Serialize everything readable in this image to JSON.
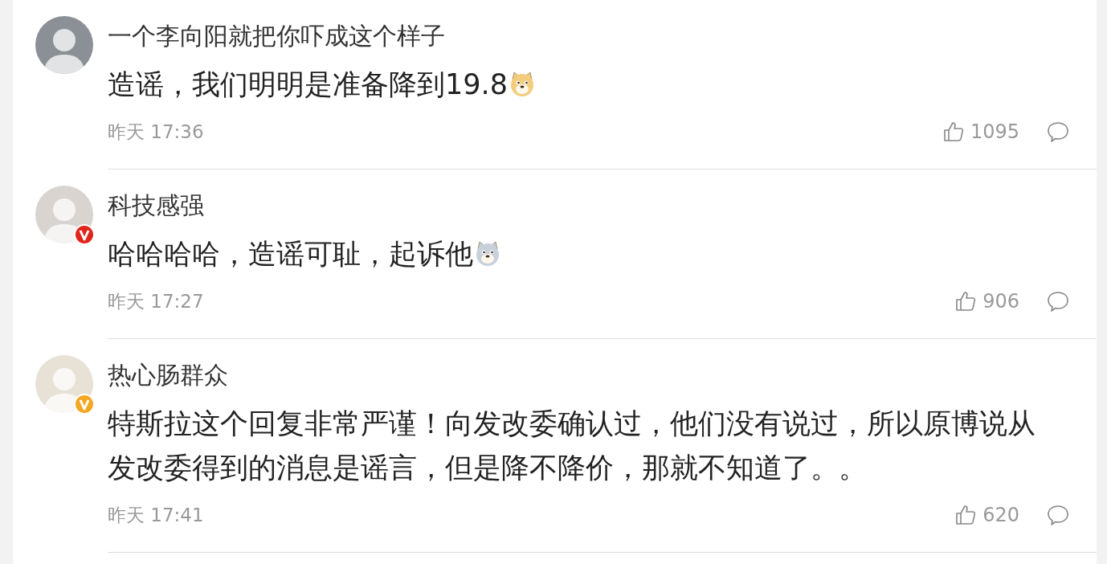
{
  "comments": [
    {
      "author": "一个李向阳就把你吓成这个样子",
      "text": "造谣，我们明明是准备降到19.8",
      "emoji": {
        "color": "#f3cd7c"
      },
      "time": "昨天 17:36",
      "likes": "1095"
    },
    {
      "author": "科技感强",
      "text": "哈哈哈哈，造谣可耻，起诉他",
      "emoji": {
        "color": "#c8d0da"
      },
      "time": "昨天 17:27",
      "likes": "906",
      "badge": {
        "color": "#e0251b"
      }
    },
    {
      "author": "热心肠群众",
      "text": "特斯拉这个回复非常严谨！向发改委确认过，他们没有说过，所以原博说从发改委得到的消息是谣言，但是降不降价，那就不知道了。。",
      "time": "昨天 17:41",
      "likes": "620",
      "badge": {
        "color": "#f5a623"
      }
    }
  ]
}
